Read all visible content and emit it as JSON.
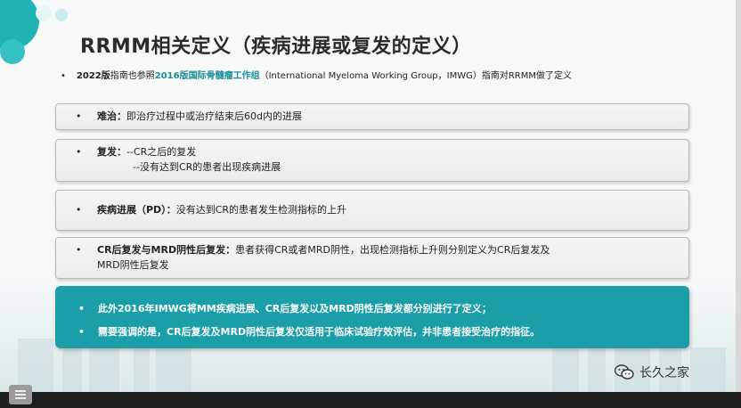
{
  "slide": {
    "title": "RRMM相关定义（疾病进展或复发的定义）",
    "subtitle": {
      "bullet": "•",
      "bold_part1": "2022版",
      "text1": "指南也参照",
      "highlight": "2016版国际骨髓瘤工作组",
      "text2": "（International Myeloma Working Group，IMWG）指南对RRMM做了定义"
    },
    "boxes": [
      {
        "bullet": "•",
        "label": "难治：",
        "lines": [
          "即治疗过程中或治疗结束后60d内的进展"
        ]
      },
      {
        "bullet": "•",
        "label": "复发：",
        "lines": [
          "--CR之后的复发",
          "--没有达到CR的患者出现疾病进展"
        ]
      },
      {
        "bullet": "•",
        "label": "疾病进展（PD）：",
        "lines": [
          "没有达到CR的患者发生检测指标的上升"
        ]
      },
      {
        "bullet": "•",
        "label": "CR后复发与MRD阴性后复发：",
        "lines": [
          "患者获得CR或者MRD阴性，出现检测指标上升则分别定义为CR后复发及",
          "MRD阴性后复发"
        ]
      }
    ],
    "highlight_box": {
      "bullet": "•",
      "line1": "此外2016年IMWG将MM疾病进展、CR后复发以及MRD阴性后复发都分别进行了定义；",
      "line2": "需要强调的是，CR后复发及MRD阴性后复发仅适用于临床试验疗效评估，并非患者接受治疗的指征。"
    }
  },
  "watermark": {
    "icon": "wechat-icon",
    "text": "长久之家"
  },
  "controls": {
    "menu_icon": "menu-icon"
  },
  "colors": {
    "accent_teal": "#1a9ea8",
    "highlight_text": "#1a8f9b",
    "deco_teal": "#1fb3b6"
  }
}
